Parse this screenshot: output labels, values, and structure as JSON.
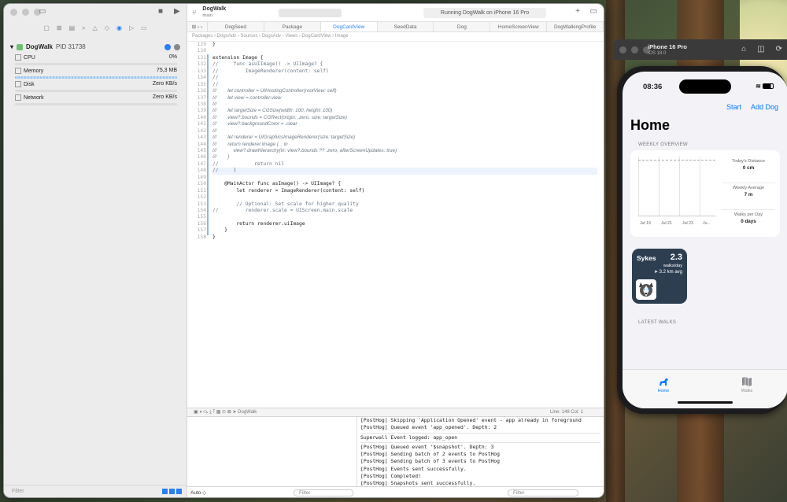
{
  "xcode": {
    "project": {
      "name": "DogWalk",
      "branch": "main"
    },
    "status": "Running DogWalk on iPhone 16 Pro",
    "tabs": [
      "DogSeed",
      "Package",
      "DogCardView",
      "SeedData",
      "Dog",
      "HomeScreenView",
      "DogWalkingProfile"
    ],
    "active_tab": "DogCardView",
    "breadcrumbs": "Packages  ›  DogsAdv  ›  Sources  ›  DogsAdv  ›  Views  ›  DogCardView  ›  Image",
    "debug_nav": {
      "process": "DogWalk",
      "pid": "PID 31738",
      "gauges": [
        {
          "label": "CPU",
          "value": "0%"
        },
        {
          "label": "Memory",
          "value": "75,3 MB"
        },
        {
          "label": "Disk",
          "value": "Zero KB/s"
        },
        {
          "label": "Network",
          "value": "Zero KB/s"
        }
      ],
      "filter_placeholder": "Filter"
    },
    "code_lines": [
      {
        "n": "129",
        "t": "}"
      },
      {
        "n": "130",
        "t": ""
      },
      {
        "n": "131",
        "t": "extension Image {"
      },
      {
        "n": "132",
        "t": "//     func asUIImage() -> UIImage? {"
      },
      {
        "n": "133",
        "t": "//         ImageRenderer(content: self)"
      },
      {
        "n": "134",
        "t": "//"
      },
      {
        "n": "135",
        "t": "//"
      },
      {
        "n": "136",
        "t": "///        let controller = UIHostingController(rootView: self)"
      },
      {
        "n": "137",
        "t": "///        let view = controller.view"
      },
      {
        "n": "138",
        "t": "///"
      },
      {
        "n": "139",
        "t": "///        let targetSize = CGSize(width: 100, height: 100)"
      },
      {
        "n": "140",
        "t": "///        view?.bounds = CGRect(origin: .zero, size: targetSize)"
      },
      {
        "n": "141",
        "t": "///        view?.backgroundColor = .clear"
      },
      {
        "n": "142",
        "t": "///"
      },
      {
        "n": "143",
        "t": "///        let renderer = UIGraphicsImageRenderer(size: targetSize)"
      },
      {
        "n": "144",
        "t": "///        return renderer.image { _ in"
      },
      {
        "n": "145",
        "t": "///            view?.drawHierarchy(in: view?.bounds ?? .zero, afterScreenUpdates: true)"
      },
      {
        "n": "146",
        "t": "///        }"
      },
      {
        "n": "147",
        "t": "//            return nil"
      },
      {
        "n": "148",
        "t": "//     }"
      },
      {
        "n": "149",
        "t": ""
      },
      {
        "n": "150",
        "t": "    @MainActor func asImage() -> UIImage? {"
      },
      {
        "n": "151",
        "t": "        let renderer = ImageRenderer(content: self)"
      },
      {
        "n": "152",
        "t": ""
      },
      {
        "n": "153",
        "t": "        // Optional: Set scale for higher quality"
      },
      {
        "n": "154",
        "t": "//         renderer.scale = UIScreen.main.scale"
      },
      {
        "n": "155",
        "t": ""
      },
      {
        "n": "156",
        "t": "        return renderer.uiImage"
      },
      {
        "n": "157",
        "t": "    }"
      },
      {
        "n": "158",
        "t": "}"
      }
    ],
    "cursor": "Line: 148  Col: 1",
    "debug_target": "DogWalk",
    "console_lines": [
      "[PostHog] Skipping 'Application Opened' event - app already in foreground",
      "[PostHog] Queued event 'app_opened'. Depth: 2",
      "---",
      "Superwall Event logged: app_open",
      "---",
      "[PostHog] Queued event '$snapshot'. Depth: 3",
      "[PostHog] Sending batch of 2 events to PostHog",
      "[PostHog] Sending batch of 3 events to PostHog",
      "[PostHog] Events sent successfully.",
      "[PostHog] Completed!",
      "[PostHog] Snapshots sent successfully.",
      "[PostHog] Completed!"
    ],
    "auto_label": "Auto ◇",
    "filter_placeholder": "Filter"
  },
  "simulator": {
    "device": "iPhone 16 Pro",
    "os": "iOS 18.0",
    "status_time": "08:36",
    "nav": {
      "start": "Start",
      "add_dog": "Add Dog"
    },
    "title": "Home",
    "weekly_overview": {
      "header": "WEEKLY OVERVIEW",
      "ticks": [
        "Jul 19",
        "Jul 21",
        "Jul 23",
        "Ju..."
      ],
      "stats": [
        {
          "label": "Today's Distance",
          "value": "0 cm"
        },
        {
          "label": "Weekly Average",
          "value": "7 m"
        },
        {
          "label": "Walks per Day",
          "value": "0 days"
        }
      ]
    },
    "dog_card": {
      "name": "Sykes",
      "walks": "2.3",
      "walks_unit": "walks/day",
      "avg": "3.2 km avg"
    },
    "latest_walks": "LATEST WALKS",
    "tabs": [
      {
        "label": "Home",
        "active": true
      },
      {
        "label": "Walks",
        "active": false
      }
    ],
    "colors": {
      "accent": "#007AFF",
      "card": "#2C3E50"
    }
  }
}
